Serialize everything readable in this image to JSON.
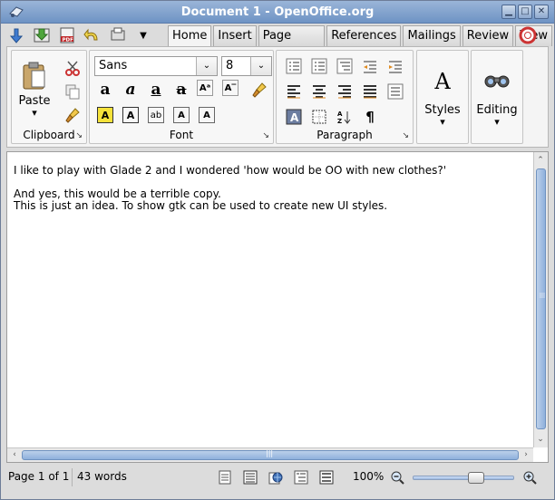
{
  "window": {
    "title": "Document 1 - OpenOffice.org"
  },
  "tabs": [
    "Home",
    "Insert",
    "Page Layout",
    "References",
    "Mailings",
    "Review",
    "View"
  ],
  "active_tab": "Home",
  "ribbon": {
    "clipboard": {
      "label": "Clipboard",
      "paste_label": "Paste",
      "paste_arrow": "▾",
      "launcher": "↘"
    },
    "font": {
      "label": "Font",
      "font_name": "Sans",
      "font_size": "8",
      "launcher": "↘",
      "btn_labels": [
        "a",
        "a",
        "a",
        "a",
        "Aᵃ",
        "A‾",
        "A",
        "A",
        "ab",
        "A",
        "A"
      ]
    },
    "paragraph": {
      "label": "Paragraph",
      "launcher": "↘",
      "pilcrow": "¶"
    },
    "styles": {
      "label": "Styles",
      "arrow": "▾",
      "glyph": "A"
    },
    "editing": {
      "label": "Editing",
      "arrow": "▾"
    }
  },
  "document": {
    "lines": [
      "I like to play with Glade 2 and I wondered 'how would be OO with new clothes?'",
      "",
      "And yes, this would be a terrible copy.",
      "This is just an idea. To show gtk can be used to create new UI styles."
    ]
  },
  "status": {
    "page": "Page 1 of 1",
    "words": "43 words",
    "zoom": "100%",
    "zoom_level": 0.65
  },
  "scroll_grip": "|||",
  "colors": {
    "accent": "#6e93c4",
    "scroll": "#8fb0dc"
  }
}
